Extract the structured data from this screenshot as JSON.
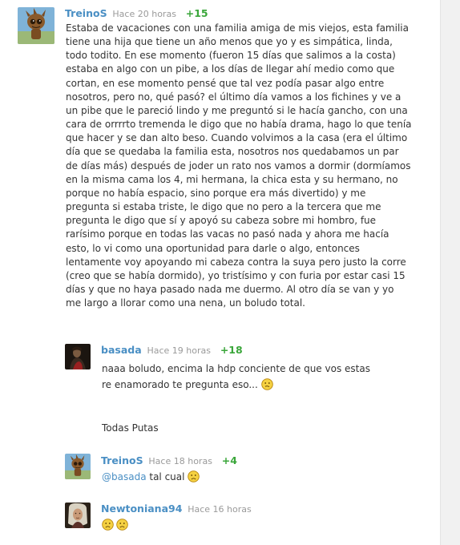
{
  "comments": [
    {
      "user": "TreinoS",
      "time": "Hace 20 horas",
      "score": "+15",
      "avatar": "groot-avatar",
      "body": "Estaba de vacaciones con una familia amiga de mis viejos, esta familia tiene una hija que tiene un año menos que yo y es simpática, linda, todo todito. En ese momento (fueron 15 días que salimos a la costa) estaba en algo con un pibe, a los días de llegar ahí medio como que cortan, en ese momento pensé que tal vez podía pasar algo entre nosotros, pero no, qué pasó? el último día vamos a los fichines y ve a un pibe que le pareció lindo y me preguntó si le hacía gancho, con una cara de orrrrto tremenda le digo que no había drama, hago lo que tenía que hacer y se dan alto beso. Cuando volvimos a la casa (era el último día que se quedaba la familia esta, nosotros nos quedabamos un par de días más) después de joder un rato nos vamos a dormir (dormíamos en la misma cama los 4, mi hermana, la chica esta y su hermano, no porque no había espacio, sino porque era más divertido) y me pregunta si estaba triste, le digo que no pero a la tercera que me pregunta le digo que sí y apoyó su cabeza sobre mi hombro, fue rarísimo porque en todas las vacas no pasó nada y ahora me hacía esto, lo vi como una oportunidad para darle o algo, entonces lentamente voy apoyando mi cabeza contra la suya pero justo la corre (creo que se había dormido), yo tristísimo y con furia por estar casi 15 días y que no haya pasado nada me duermo. Al otro día se van y yo me largo a llorar como una nena, un boludo total."
    },
    {
      "user": "basada",
      "time": "Hace 19 horas",
      "score": "+18",
      "avatar": "painting-avatar",
      "body_line1": "naaa boludo, encima la hdp conciente de que vos estas re enamorado te pregunta eso...",
      "body_line2": "Todas Putas",
      "emoji": "confused-emoji"
    },
    {
      "user": "TreinoS",
      "time": "Hace 18 horas",
      "score": "+4",
      "avatar": "groot-avatar",
      "mention": "@basada",
      "body": "tal cual",
      "emoji": "sad-emoji"
    },
    {
      "user": "Newtoniana94",
      "time": "Hace 16 horas",
      "avatar": "newton-portrait-avatar",
      "emojis": [
        "sad-emoji",
        "sad-emoji"
      ]
    }
  ],
  "colors": {
    "username": "#4a8fc4",
    "timestamp": "#9a9a9a",
    "score": "#3aa63a",
    "text": "#333333",
    "emoji_fill": "#f5d142",
    "emoji_stroke": "#b8860b"
  }
}
